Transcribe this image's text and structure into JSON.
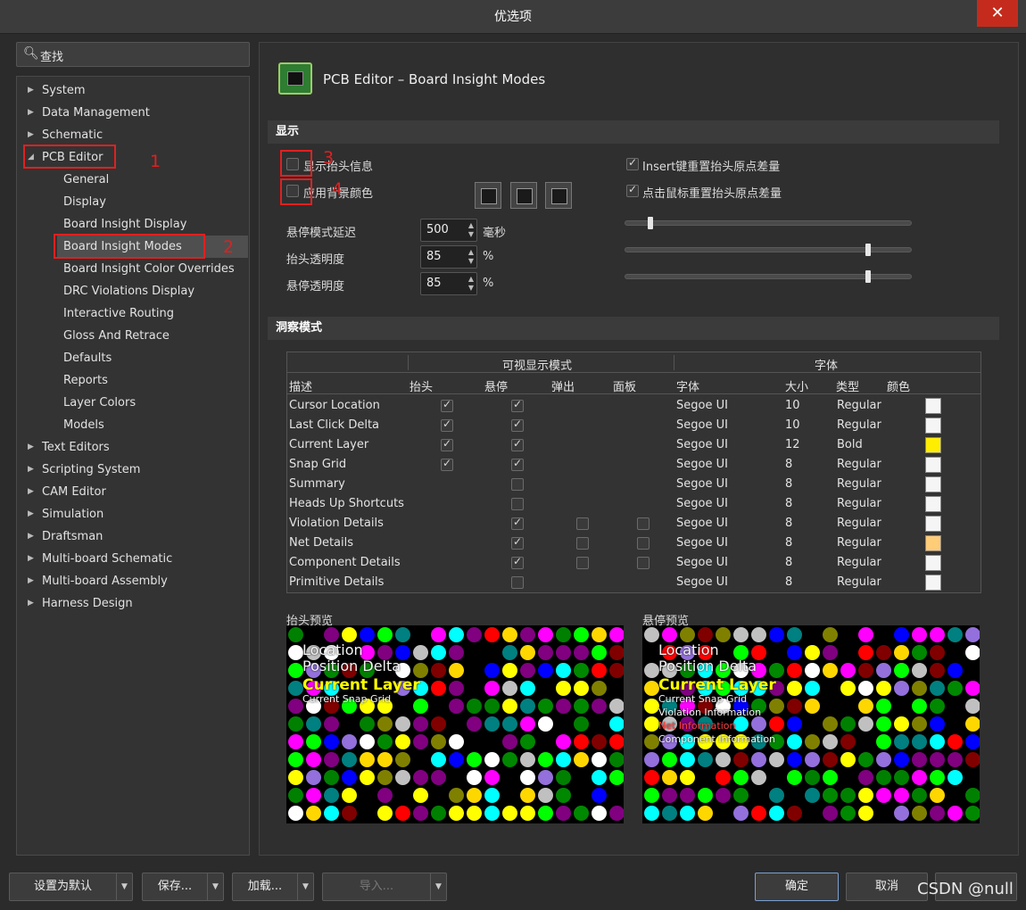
{
  "window": {
    "title": "优选项",
    "close_icon": "close-icon"
  },
  "search": {
    "placeholder": "查找"
  },
  "tree": {
    "top": [
      {
        "label": "System"
      },
      {
        "label": "Data Management"
      },
      {
        "label": "Schematic"
      },
      {
        "label": "PCB Editor",
        "expanded": true
      }
    ],
    "pcb_children": [
      {
        "label": "General"
      },
      {
        "label": "Display"
      },
      {
        "label": "Board Insight Display"
      },
      {
        "label": "Board Insight Modes",
        "selected": true
      },
      {
        "label": "Board Insight Color Overrides"
      },
      {
        "label": "DRC Violations Display"
      },
      {
        "label": "Interactive Routing"
      },
      {
        "label": "Gloss And Retrace"
      },
      {
        "label": "Defaults"
      },
      {
        "label": "Reports"
      },
      {
        "label": "Layer Colors"
      },
      {
        "label": "Models"
      }
    ],
    "bottom": [
      {
        "label": "Text Editors"
      },
      {
        "label": "Scripting System"
      },
      {
        "label": "CAM Editor"
      },
      {
        "label": "Simulation"
      },
      {
        "label": "Draftsman"
      },
      {
        "label": "Multi-board Schematic"
      },
      {
        "label": "Multi-board Assembly"
      },
      {
        "label": "Harness Design"
      }
    ]
  },
  "annotations": [
    "1",
    "2",
    "3",
    "4"
  ],
  "page": {
    "title": "PCB Editor – Board Insight Modes"
  },
  "display": {
    "section": "显示",
    "show_heads_up": "显示抬头信息",
    "use_bg_color": "应用背景颜色",
    "insert_reset": "Insert键重置抬头原点差量",
    "click_reset": "点击鼠标重置抬头原点差量",
    "hover_delay": {
      "label": "悬停模式延迟",
      "value": "500",
      "unit": "毫秒"
    },
    "heads_up_opacity": {
      "label": "抬头透明度",
      "value": "85",
      "unit": "%"
    },
    "hover_opacity": {
      "label": "悬停透明度",
      "value": "85",
      "unit": "%"
    },
    "sliders": [
      0.08,
      0.85,
      0.85
    ]
  },
  "insight": {
    "section": "洞察模式",
    "group_visible": "可视显示模式",
    "group_font": "字体",
    "cols": {
      "desc": "描述",
      "headsup": "抬头",
      "hover": "悬停",
      "popup": "弹出",
      "panel": "面板",
      "font": "字体",
      "size": "大小",
      "type": "类型",
      "color": "颜色"
    },
    "rows": [
      {
        "desc": "Cursor Location",
        "h": 1,
        "v": 1,
        "p": -1,
        "n": -1,
        "font": "Segoe UI",
        "size": "10",
        "type": "Regular",
        "color": "#f5f5f5"
      },
      {
        "desc": "Last Click Delta",
        "h": 1,
        "v": 1,
        "p": -1,
        "n": -1,
        "font": "Segoe UI",
        "size": "10",
        "type": "Regular",
        "color": "#f5f5f5"
      },
      {
        "desc": "Current Layer",
        "h": 1,
        "v": 1,
        "p": -1,
        "n": -1,
        "font": "Segoe UI",
        "size": "12",
        "type": "Bold",
        "color": "#ffee00"
      },
      {
        "desc": "Snap Grid",
        "h": 1,
        "v": 1,
        "p": -1,
        "n": -1,
        "font": "Segoe UI",
        "size": "8",
        "type": "Regular",
        "color": "#f5f5f5"
      },
      {
        "desc": "Summary",
        "h": -1,
        "v": 0,
        "p": -1,
        "n": -1,
        "font": "Segoe UI",
        "size": "8",
        "type": "Regular",
        "color": "#f5f5f5"
      },
      {
        "desc": "Heads Up Shortcuts",
        "h": -1,
        "v": 0,
        "p": -1,
        "n": -1,
        "font": "Segoe UI",
        "size": "8",
        "type": "Regular",
        "color": "#f5f5f5"
      },
      {
        "desc": "Violation Details",
        "h": -1,
        "v": 1,
        "p": 0,
        "n": 0,
        "font": "Segoe UI",
        "size": "8",
        "type": "Regular",
        "color": "#f5f5f5"
      },
      {
        "desc": "Net Details",
        "h": -1,
        "v": 1,
        "p": 0,
        "n": 0,
        "font": "Segoe UI",
        "size": "8",
        "type": "Regular",
        "color": "#ffcc77"
      },
      {
        "desc": "Component Details",
        "h": -1,
        "v": 1,
        "p": 0,
        "n": 0,
        "font": "Segoe UI",
        "size": "8",
        "type": "Regular",
        "color": "#f5f5f5"
      },
      {
        "desc": "Primitive Details",
        "h": -1,
        "v": 0,
        "p": -1,
        "n": -1,
        "font": "Segoe UI",
        "size": "8",
        "type": "Regular",
        "color": "#f5f5f5"
      }
    ]
  },
  "previews": {
    "headsup_label": "抬头预览",
    "hover_label": "悬停预览",
    "headsup_lines": [
      "Location",
      "Position Delta",
      "Current Layer",
      "Current Snap Grid"
    ],
    "hover_lines": [
      "Location",
      "Position Delta",
      "Current Layer",
      "Current Snap Grid",
      "Violation Information",
      "Net Information",
      "Component Information"
    ]
  },
  "buttons": {
    "reset": "设置为默认",
    "save": "保存...",
    "load": "加载...",
    "import": "导入...",
    "ok": "确定",
    "cancel": "取消"
  },
  "watermark": "CSDN @null"
}
